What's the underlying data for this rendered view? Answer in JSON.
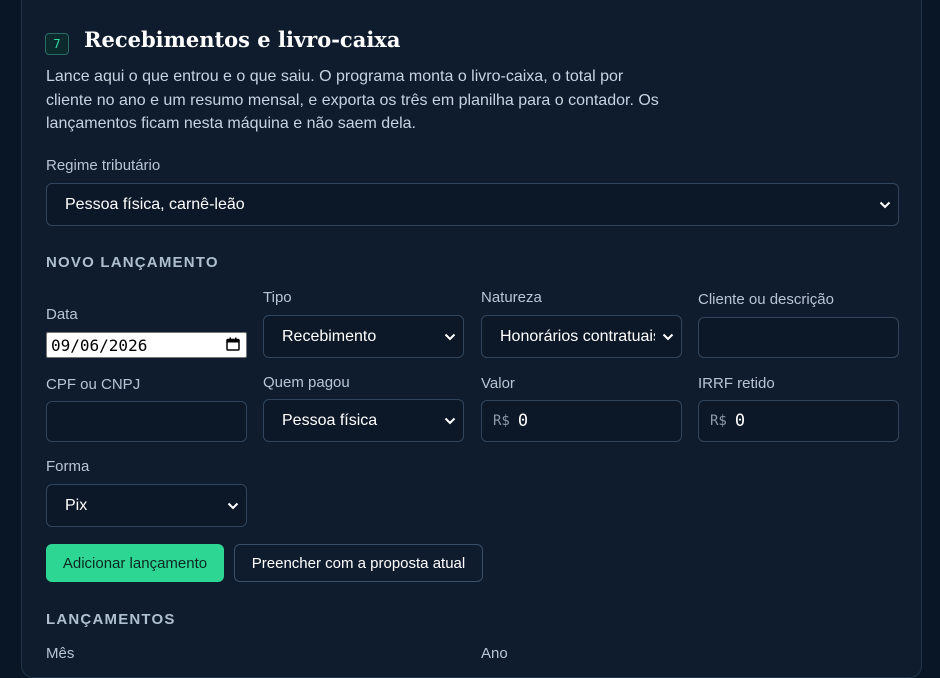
{
  "header": {
    "step_badge": "7",
    "title": "Recebimentos e livro-caixa",
    "description": "Lance aqui o que entrou e o que saiu. O programa monta o livro-caixa, o total por cliente no ano e um resumo mensal, e exporta os três em planilha para o contador. Os lançamentos ficam nesta máquina e não saem dela."
  },
  "regime": {
    "label": "Regime tributário",
    "value": "Pessoa física, carnê-leão"
  },
  "new_entry": {
    "section_title": "NOVO LANÇAMENTO",
    "date": {
      "label": "Data",
      "value": "09/06/2026"
    },
    "type": {
      "label": "Tipo",
      "value": "Recebimento"
    },
    "nature": {
      "label": "Natureza",
      "value": "Honorários contratuais"
    },
    "client": {
      "label": "Cliente ou descrição",
      "value": ""
    },
    "document": {
      "label": "CPF ou CNPJ",
      "value": ""
    },
    "payer": {
      "label": "Quem pagou",
      "value": "Pessoa física"
    },
    "amount": {
      "label": "Valor",
      "currency": "R$",
      "value": "0"
    },
    "irrf": {
      "label": "IRRF retido",
      "currency": "R$",
      "value": "0"
    },
    "method": {
      "label": "Forma",
      "value": "Pix"
    }
  },
  "actions": {
    "add_label": "Adicionar lançamento",
    "fill_label": "Preencher com a proposta atual"
  },
  "entries": {
    "section_title": "LANÇAMENTOS",
    "month_label": "Mês",
    "year_label": "Ano"
  },
  "colors": {
    "accent": "#2ed693",
    "background": "#081626",
    "card": "#0f1c2d"
  }
}
